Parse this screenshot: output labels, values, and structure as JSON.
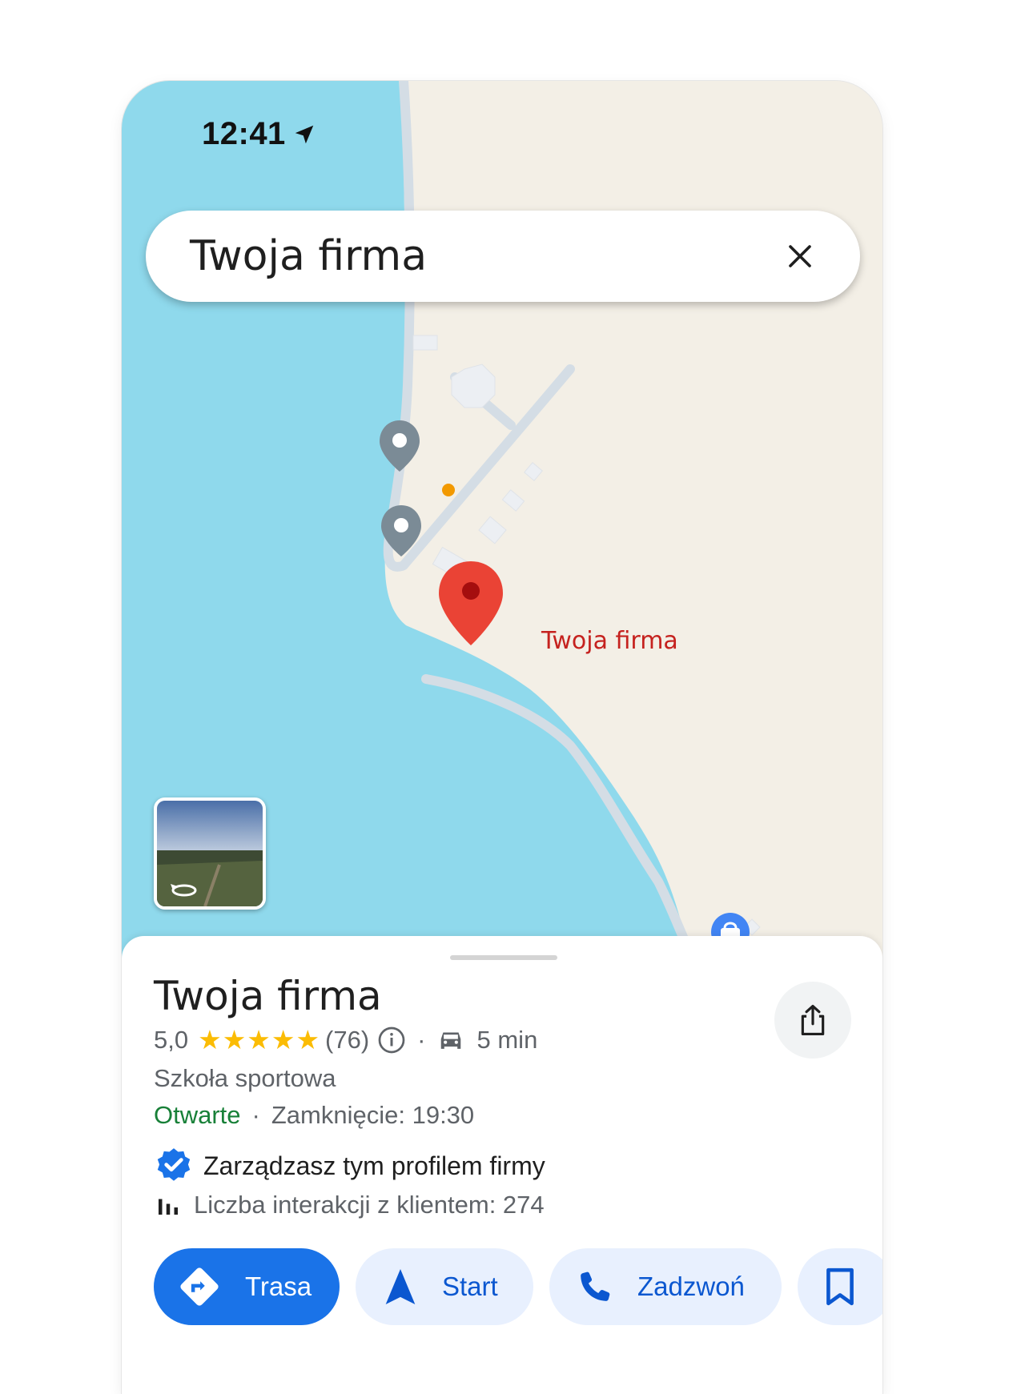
{
  "status_bar": {
    "time": "12:41"
  },
  "search": {
    "query": "Twoja firma"
  },
  "map": {
    "pin_label": "Twoja firma",
    "water_color": "#8fd9ec",
    "land_color": "#f3efe6",
    "road_color": "#d4dde5"
  },
  "place": {
    "title": "Twoja firma",
    "rating": "5,0",
    "stars": "★★★★★",
    "review_count": "(76)",
    "drive_time": "5 min",
    "category": "Szkoła sportowa",
    "open_status": "Otwarte",
    "closing": "Zamknięcie: 19:30",
    "managed_text": "Zarządzasz tym profilem firmy",
    "interactions": "Liczba interakcji z klientem: 274"
  },
  "actions": {
    "directions": "Trasa",
    "start": "Start",
    "call": "Zadzwoń"
  },
  "colors": {
    "accent": "#1a73e8",
    "open_green": "#188038",
    "pin_red": "#ea4335",
    "star_yellow": "#fbbc04"
  }
}
